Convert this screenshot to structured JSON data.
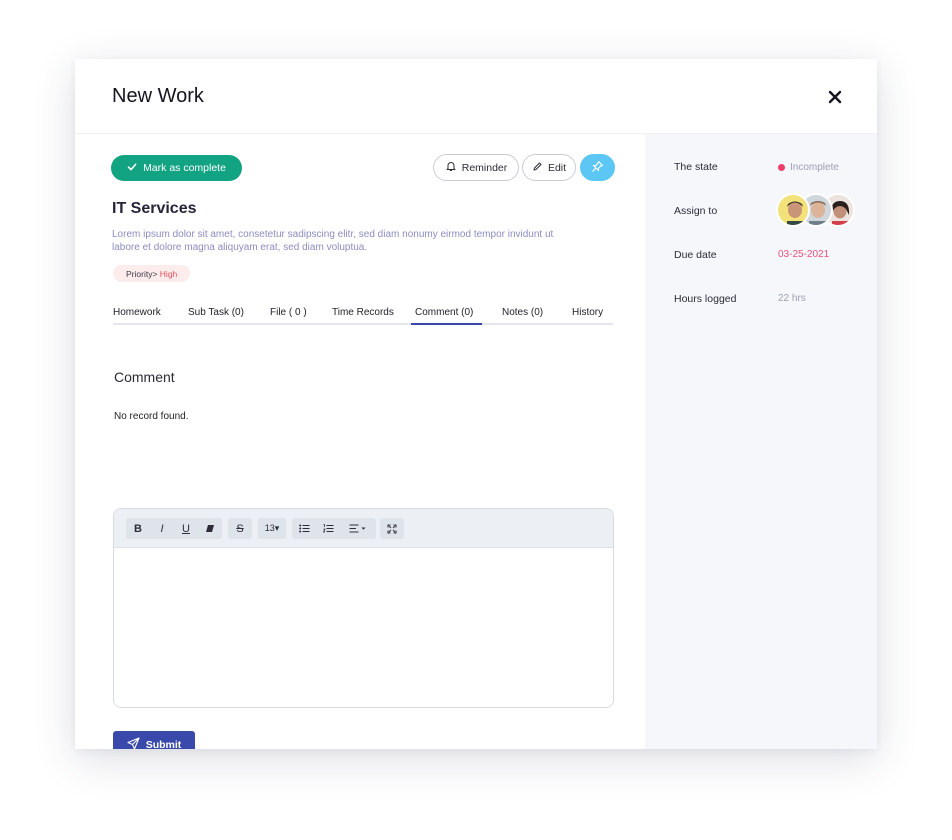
{
  "modal": {
    "title": "New Work"
  },
  "actions": {
    "mark_complete": "Mark as complete",
    "reminder": "Reminder",
    "edit": "Edit"
  },
  "task": {
    "title": "IT Services",
    "description": "Lorem ipsum dolor sit amet, consetetur sadipscing elitr, sed diam nonumy eirmod tempor invidunt ut labore et dolore magna aliquyam erat, sed diam voluptua.",
    "priority_label": "Priority>",
    "priority_value": "High"
  },
  "tabs": [
    {
      "label": "Homework"
    },
    {
      "label": "Sub Task (0)"
    },
    {
      "label": "File ( 0 )"
    },
    {
      "label": "Time Records"
    },
    {
      "label": "Comment (0)"
    },
    {
      "label": "Notes (0)"
    },
    {
      "label": "History"
    }
  ],
  "active_tab": "Comment (0)",
  "comment": {
    "heading": "Comment",
    "empty_text": "No record found.",
    "toolbar": {
      "bold": "B",
      "italic": "I",
      "underline": "U",
      "strike": "S",
      "font_size": "13▾"
    },
    "submit": "Submit"
  },
  "details": {
    "state_label": "The state",
    "state_value": "Incomplete",
    "assign_label": "Assign to",
    "due_label": "Due date",
    "due_value": "03-25-2021",
    "hours_label": "Hours logged",
    "hours_value": "22 hrs"
  },
  "colors": {
    "accent": "#3949ab",
    "complete_green": "#12a383",
    "pin_blue": "#5cc7f5",
    "state_dot": "#ee3d6a",
    "due_date": "#e8507a"
  }
}
